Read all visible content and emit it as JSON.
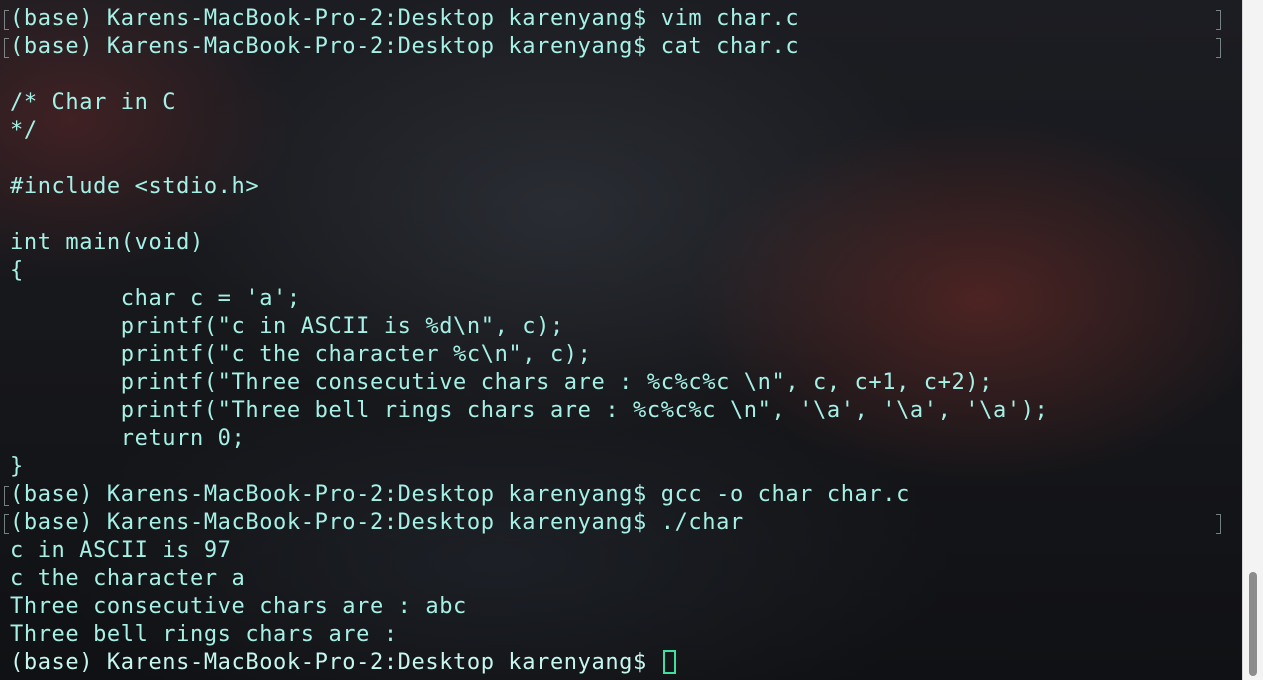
{
  "terminal": {
    "lines": [
      "(base) Karens-MacBook-Pro-2:Desktop karenyang$ vim char.c",
      "(base) Karens-MacBook-Pro-2:Desktop karenyang$ cat char.c",
      "",
      "/* Char in C",
      "*/",
      "",
      "#include <stdio.h>",
      "",
      "int main(void)",
      "{",
      "        char c = 'a';",
      "        printf(\"c in ASCII is %d\\n\", c);",
      "        printf(\"c the character %c\\n\", c);",
      "        printf(\"Three consecutive chars are : %c%c%c \\n\", c, c+1, c+2);",
      "        printf(\"Three bell rings chars are : %c%c%c \\n\", '\\a', '\\a', '\\a');",
      "        return 0;",
      "}",
      "(base) Karens-MacBook-Pro-2:Desktop karenyang$ gcc -o char char.c",
      "(base) Karens-MacBook-Pro-2:Desktop karenyang$ ./char",
      "c in ASCII is 97",
      "c the character a",
      "Three consecutive chars are : abc",
      "Three bell rings chars are :"
    ],
    "prompt": "(base) Karens-MacBook-Pro-2:Desktop karenyang$ "
  },
  "colors": {
    "text": "#a6f1e6",
    "cursor": "#3ee0a0"
  },
  "scrollbar": {
    "position": 0.84
  }
}
